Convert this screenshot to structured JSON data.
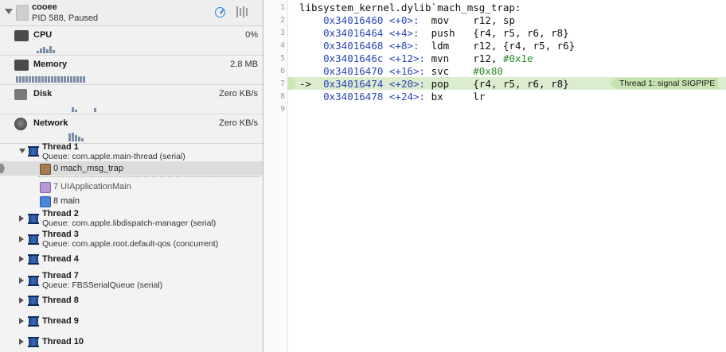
{
  "process": {
    "name": "cooee",
    "status": "PID 588, Paused"
  },
  "gauges": {
    "cpu": {
      "label": "CPU",
      "value": "0%"
    },
    "memory": {
      "label": "Memory",
      "value": "2.8 MB"
    },
    "disk": {
      "label": "Disk",
      "value": "Zero KB/s"
    },
    "network": {
      "label": "Network",
      "value": "Zero KB/s"
    }
  },
  "threads": {
    "t1": {
      "name": "Thread 1",
      "queue": "Queue: com.apple.main-thread (serial)"
    },
    "t2": {
      "name": "Thread 2",
      "queue": "Queue: com.apple.libdispatch-manager (serial)"
    },
    "t3": {
      "name": "Thread 3",
      "queue": "Queue: com.apple.root.default-qos (concurrent)"
    },
    "t4": {
      "name": "Thread 4"
    },
    "t7": {
      "name": "Thread 7",
      "queue": "Queue: FBSSerialQueue (serial)"
    },
    "t8": {
      "name": "Thread 8"
    },
    "t9": {
      "name": "Thread 9"
    },
    "t10": {
      "name": "Thread 10"
    }
  },
  "frames": {
    "f0": "0 mach_msg_trap",
    "f7": "7 UIApplicationMain",
    "f8": "8 main"
  },
  "editor": {
    "line_numbers": [
      "1",
      "2",
      "3",
      "4",
      "5",
      "6",
      "7",
      "8",
      "9"
    ],
    "header": "libsystem_kernel.dylib`mach_msg_trap:",
    "lines": [
      {
        "prefix": "",
        "addr": "0x34016460",
        "off": "<+0>:",
        "op": "mov",
        "args": "r12, sp"
      },
      {
        "prefix": "",
        "addr": "0x34016464",
        "off": "<+4>:",
        "op": "push",
        "args": "{r4, r5, r6, r8}"
      },
      {
        "prefix": "",
        "addr": "0x34016468",
        "off": "<+8>:",
        "op": "ldm",
        "args": "r12, {r4, r5, r6}"
      },
      {
        "prefix": "",
        "addr": "0x3401646c",
        "off": "<+12>:",
        "op": "mvn",
        "args": "r12, ",
        "imm": "#0x1e"
      },
      {
        "prefix": "",
        "addr": "0x34016470",
        "off": "<+16>:",
        "op": "svc",
        "args": "",
        "imm": "#0x80"
      },
      {
        "prefix": "->",
        "addr": "0x34016474",
        "off": "<+20>:",
        "op": "pop",
        "args": "{r4, r5, r6, r8}"
      },
      {
        "prefix": "",
        "addr": "0x34016478",
        "off": "<+24>:",
        "op": "bx",
        "args": "lr"
      }
    ],
    "badge": "Thread 1: signal SIGPIPE"
  },
  "colors": {
    "accent": "#2d7ff0",
    "pc_highlight": "#dcedcf",
    "address": "#2b46b8",
    "immediate": "#2a8a2a"
  }
}
